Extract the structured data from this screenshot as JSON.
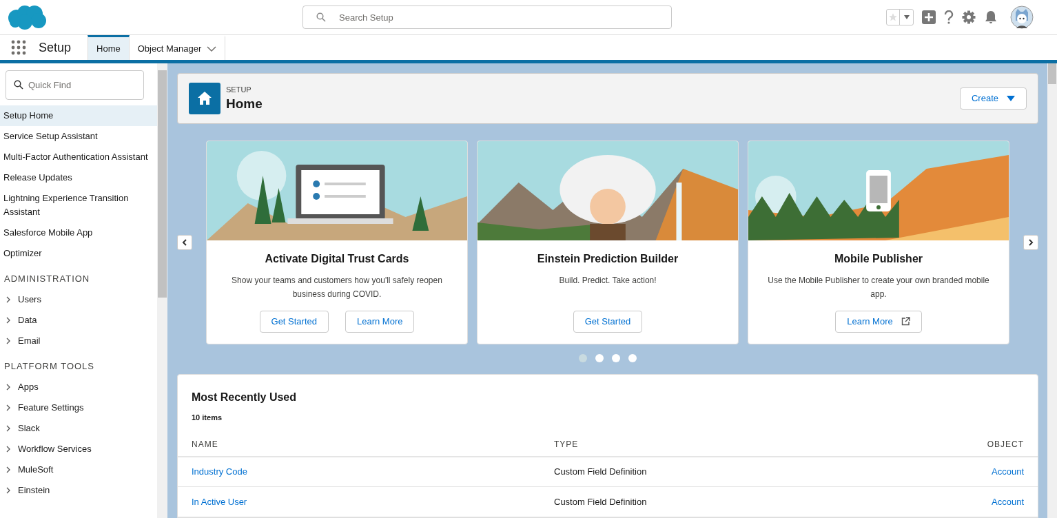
{
  "header": {
    "search": {
      "placeholder": "Search Setup"
    }
  },
  "nav": {
    "app_name": "Setup",
    "tabs": [
      {
        "label": "Home",
        "selected": true,
        "has_menu": false
      },
      {
        "label": "Object Manager",
        "selected": false,
        "has_menu": true
      }
    ]
  },
  "sidebar": {
    "quick_find": {
      "placeholder": "Quick Find"
    },
    "items": [
      {
        "kind": "link",
        "label": "Setup Home",
        "selected": true
      },
      {
        "kind": "link",
        "label": "Service Setup Assistant",
        "selected": false
      },
      {
        "kind": "link",
        "label": "Multi-Factor Authentication Assistant",
        "selected": false
      },
      {
        "kind": "link",
        "label": "Release Updates",
        "selected": false
      },
      {
        "kind": "link",
        "label": "Lightning Experience Transition Assistant",
        "selected": false
      },
      {
        "kind": "link",
        "label": "Salesforce Mobile App",
        "selected": false
      },
      {
        "kind": "link",
        "label": "Optimizer",
        "selected": false
      },
      {
        "kind": "section",
        "label": "ADMINISTRATION"
      },
      {
        "kind": "group",
        "label": "Users",
        "expanded": false
      },
      {
        "kind": "group",
        "label": "Data",
        "expanded": false
      },
      {
        "kind": "group",
        "label": "Email",
        "expanded": false
      },
      {
        "kind": "section",
        "label": "PLATFORM TOOLS"
      },
      {
        "kind": "group",
        "label": "Apps",
        "expanded": false
      },
      {
        "kind": "group",
        "label": "Feature Settings",
        "expanded": false
      },
      {
        "kind": "group",
        "label": "Slack",
        "expanded": false
      },
      {
        "kind": "group",
        "label": "Workflow Services",
        "expanded": false
      },
      {
        "kind": "group",
        "label": "MuleSoft",
        "expanded": false
      },
      {
        "kind": "group",
        "label": "Einstein",
        "expanded": false
      }
    ]
  },
  "page_header": {
    "eyebrow": "SETUP",
    "title": "Home",
    "create_button": "Create"
  },
  "carousel": {
    "cards": [
      {
        "title": "Activate Digital Trust Cards",
        "description": "Show your teams and customers how you'll safely reopen business during COVID.",
        "buttons": [
          {
            "label": "Get Started",
            "external": false
          },
          {
            "label": "Learn More",
            "external": false
          }
        ]
      },
      {
        "title": "Einstein Prediction Builder",
        "description": "Build. Predict. Take action!",
        "buttons": [
          {
            "label": "Get Started",
            "external": false
          }
        ]
      },
      {
        "title": "Mobile Publisher",
        "description": "Use the Mobile Publisher to create your own branded mobile app.",
        "buttons": [
          {
            "label": "Learn More",
            "external": true
          }
        ]
      }
    ],
    "dots": [
      {
        "selected": true
      },
      {
        "selected": false
      },
      {
        "selected": false
      },
      {
        "selected": false
      }
    ]
  },
  "recent": {
    "title": "Most Recently Used",
    "count": "10 items",
    "columns": [
      "NAME",
      "TYPE",
      "OBJECT"
    ],
    "rows": [
      {
        "name": "Industry Code",
        "type": "Custom Field Definition",
        "object": "Account"
      },
      {
        "name": "In Active User",
        "type": "Custom Field Definition",
        "object": "Account"
      }
    ]
  }
}
